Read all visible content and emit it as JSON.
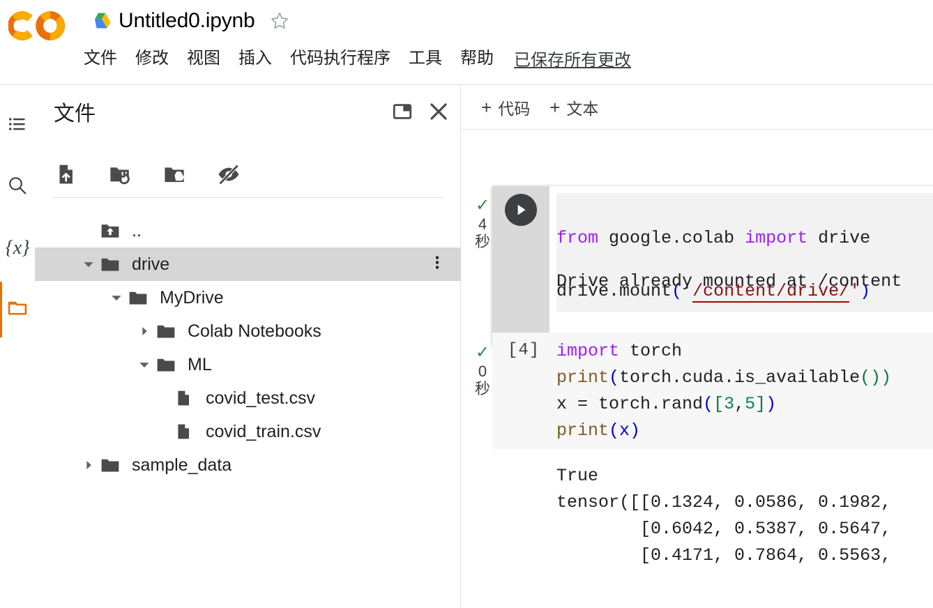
{
  "app": {
    "logo_name": "colab-logo",
    "brand_colors": {
      "orange_dark": "#e8710a",
      "orange_light": "#f9ab00",
      "accent": "#e8710a"
    }
  },
  "titlebar": {
    "drive_icon": "google-drive-icon",
    "document_title": "Untitled0.ipynb",
    "star_icon": "star-outline-icon"
  },
  "menu": {
    "items": [
      {
        "label": "文件"
      },
      {
        "label": "修改"
      },
      {
        "label": "视图"
      },
      {
        "label": "插入"
      },
      {
        "label": "代码执行程序"
      },
      {
        "label": "工具"
      },
      {
        "label": "帮助"
      }
    ],
    "save_status": "已保存所有更改"
  },
  "rail": {
    "items": [
      {
        "name": "toc-icon",
        "label": "目录",
        "active": false
      },
      {
        "name": "search-icon",
        "label": "查找和替换",
        "active": false
      },
      {
        "name": "variables-icon",
        "label": "{x}",
        "active": false
      },
      {
        "name": "folder-icon",
        "label": "文件",
        "active": true
      }
    ]
  },
  "file_panel": {
    "title": "文件",
    "header_icons": [
      {
        "name": "dock-panel-icon"
      },
      {
        "name": "close-icon"
      }
    ],
    "toolbar_icons": [
      {
        "name": "upload-file-icon"
      },
      {
        "name": "refresh-folder-icon"
      },
      {
        "name": "mount-drive-icon"
      },
      {
        "name": "toggle-hidden-files-icon"
      }
    ],
    "tree": [
      {
        "label": "..",
        "type": "parent",
        "indent": 0,
        "arrow": "none",
        "selected": false,
        "menu": false
      },
      {
        "label": "drive",
        "type": "folder",
        "indent": 0,
        "arrow": "expanded",
        "selected": true,
        "menu": true
      },
      {
        "label": "MyDrive",
        "type": "folder",
        "indent": 1,
        "arrow": "expanded",
        "selected": false,
        "menu": false
      },
      {
        "label": "Colab Notebooks",
        "type": "folder",
        "indent": 2,
        "arrow": "collapsed",
        "selected": false,
        "menu": false
      },
      {
        "label": "ML",
        "type": "folder",
        "indent": 2,
        "arrow": "expanded",
        "selected": false,
        "menu": false
      },
      {
        "label": "covid_test.csv",
        "type": "file",
        "indent": 3,
        "arrow": "none",
        "selected": false,
        "menu": false
      },
      {
        "label": "covid_train.csv",
        "type": "file",
        "indent": 3,
        "arrow": "none",
        "selected": false,
        "menu": false
      },
      {
        "label": "sample_data",
        "type": "folder",
        "indent": 0,
        "arrow": "collapsed",
        "selected": false,
        "menu": false
      }
    ]
  },
  "notebook": {
    "toolbar": {
      "add_code_label": "代码",
      "add_text_label": "文本",
      "plus": "+"
    },
    "cells": [
      {
        "status_check": "✓",
        "status_time": "4",
        "status_unit": "秒",
        "prompt": "",
        "show_run_button": true,
        "focused": true,
        "code_lines": [
          [
            {
              "t": "from ",
              "c": "kw"
            },
            {
              "t": "google.colab ",
              "c": ""
            },
            {
              "t": "import ",
              "c": "kw"
            },
            {
              "t": "drive",
              "c": ""
            }
          ],
          [
            {
              "t": "drive.mount",
              "c": ""
            },
            {
              "t": "(",
              "c": "paren"
            },
            {
              "t": "'",
              "c": "str"
            },
            {
              "t": "/content/drive/",
              "c": "str-underline"
            },
            {
              "t": "'",
              "c": "str"
            },
            {
              "t": ")",
              "c": "paren"
            }
          ]
        ],
        "output_lines": [
          "Drive already mounted at /content"
        ]
      },
      {
        "status_check": "✓",
        "status_time": "0",
        "status_unit": "秒",
        "prompt": "[4]",
        "show_run_button": false,
        "focused": false,
        "code_lines": [
          [
            {
              "t": "import ",
              "c": "kw"
            },
            {
              "t": "torch",
              "c": ""
            }
          ],
          [
            {
              "t": "print",
              "c": "fn"
            },
            {
              "t": "(",
              "c": "paren"
            },
            {
              "t": "torch.cuda.is_available",
              "c": ""
            },
            {
              "t": "(",
              "c": "paren-g"
            },
            {
              "t": ")",
              "c": "paren-g"
            },
            {
              "t": ")",
              "c": "paren-g"
            }
          ],
          [
            {
              "t": "x = torch.rand",
              "c": ""
            },
            {
              "t": "(",
              "c": "paren"
            },
            {
              "t": "[",
              "c": "paren-g"
            },
            {
              "t": "3",
              "c": "num"
            },
            {
              "t": ",",
              "c": ""
            },
            {
              "t": "5",
              "c": "num"
            },
            {
              "t": "]",
              "c": "paren-g"
            },
            {
              "t": ")",
              "c": "paren"
            }
          ],
          [
            {
              "t": "print",
              "c": "fn"
            },
            {
              "t": "(",
              "c": "paren"
            },
            {
              "t": "x",
              "c": "paren"
            },
            {
              "t": ")",
              "c": "paren"
            }
          ]
        ],
        "output_lines": [
          "True",
          "tensor([[0.1324, 0.0586, 0.1982,",
          "        [0.6042, 0.5387, 0.5647,",
          "        [0.4171, 0.7864, 0.5563,"
        ]
      }
    ]
  }
}
